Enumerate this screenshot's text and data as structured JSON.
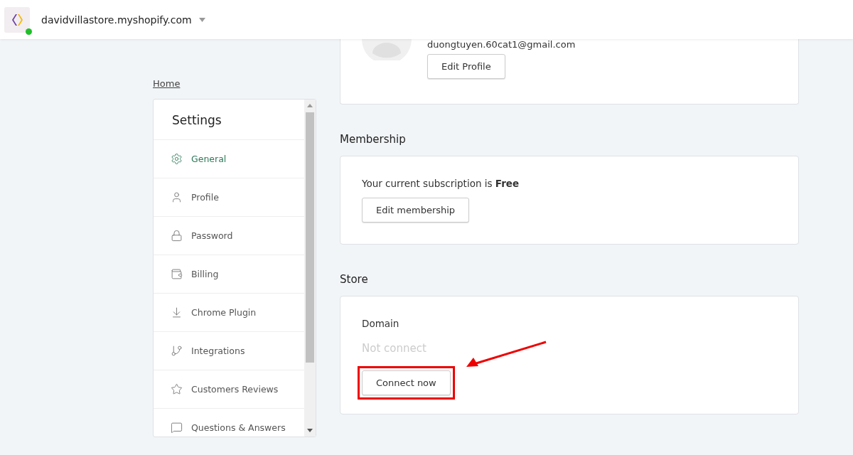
{
  "header": {
    "store": "davidvillastore.myshopify.com",
    "online": true
  },
  "breadcrumb": "Home",
  "sidebar": {
    "title": "Settings",
    "items": [
      {
        "label": "General",
        "selected": true
      },
      {
        "label": "Profile",
        "selected": false
      },
      {
        "label": "Password",
        "selected": false
      },
      {
        "label": "Billing",
        "selected": false
      },
      {
        "label": "Chrome Plugin",
        "selected": false
      },
      {
        "label": "Integrations",
        "selected": false
      },
      {
        "label": "Customers Reviews",
        "selected": false
      },
      {
        "label": "Questions & Answers",
        "selected": false
      }
    ]
  },
  "profile": {
    "email": "duongtuyen.60cat1@gmail.com",
    "button": "Edit Profile"
  },
  "membership": {
    "title": "Membership",
    "text": "Your current subscription is **Free**",
    "button": "Edit membership"
  },
  "store": {
    "title": "Store",
    "label": "Domain",
    "value": "Not connect",
    "button": "Connect now",
    "highlighted": true
  }
}
